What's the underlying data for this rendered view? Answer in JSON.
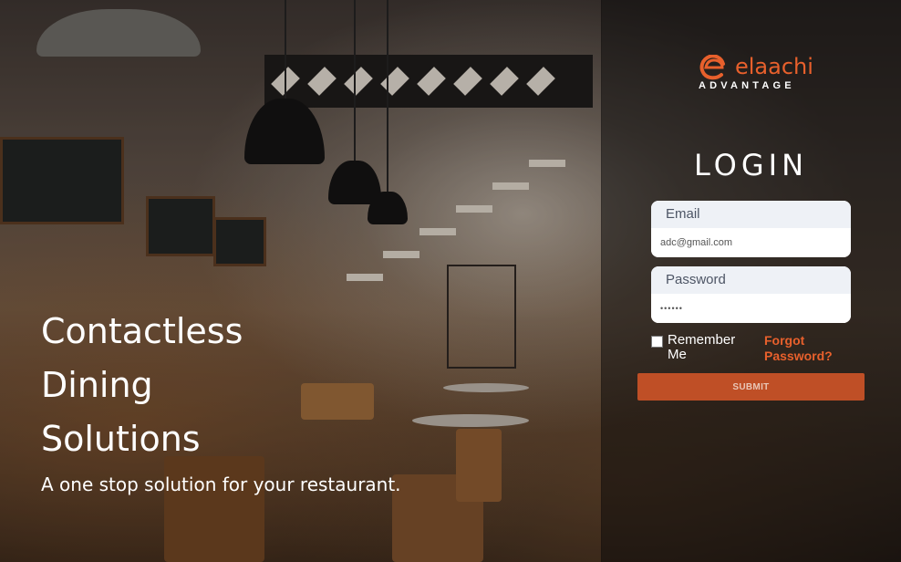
{
  "brand": {
    "name": "elaachi",
    "subtitle": "ADVANTAGE",
    "accent_color": "#e8602c"
  },
  "hero": {
    "lines": [
      "Contactless",
      "Dining",
      "Solutions"
    ],
    "tagline": "A one stop solution for your restaurant."
  },
  "login": {
    "title": "LOGIN",
    "email_label": "Email",
    "email_value": "adc@gmail.com",
    "password_label": "Password",
    "password_value": "••••••",
    "remember_label": "Remember Me",
    "remember_checked": false,
    "forgot_label": "Forgot Password?",
    "submit_label": "SUBMIT"
  },
  "icons": {
    "logo": "elaachi-logo-icon"
  }
}
